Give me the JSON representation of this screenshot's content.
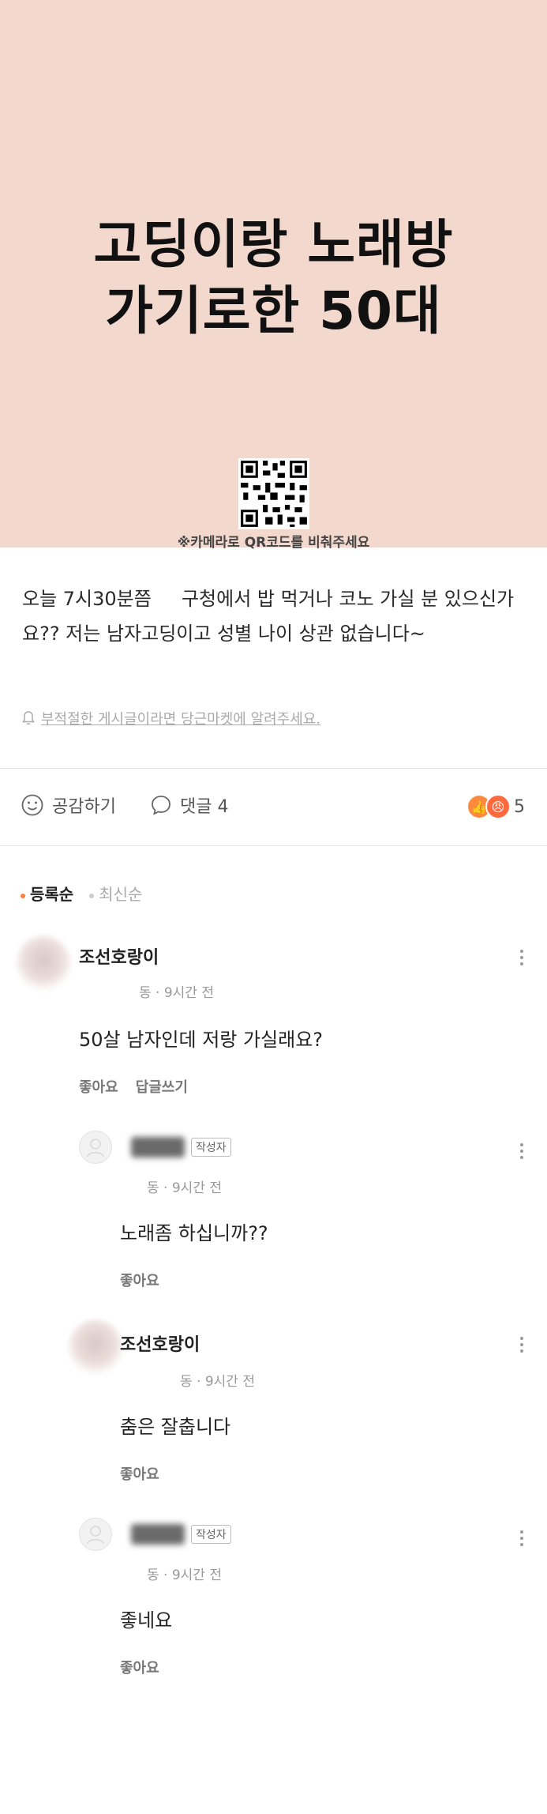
{
  "banner": {
    "title_line1": "고딩이랑 노래방",
    "title_line2": "가기로한 50대",
    "qr_caption": "※카메라로 QR코드를 비춰주세요"
  },
  "post": {
    "line1": "오늘 7시30분쯤     구청에서 밥 먹거나 코노 가실 분 있으신가",
    "line2": "요?? 저는 남자고딩이고 성별 나이 상관 없습니다~",
    "report_text": "부적절한 게시글이라면 당근마켓에 알려주세요."
  },
  "actions": {
    "like_label": "공감하기",
    "comment_label": "댓글 4",
    "reaction_count": "5"
  },
  "sort": {
    "active": "등록순",
    "inactive": "최신순"
  },
  "comments": [
    {
      "nickname": "조선호랑이",
      "meta": "동 · 9시간 전",
      "text": "50살 남자인데 저랑 가실래요?",
      "like": "좋아요",
      "reply": "답글쓰기"
    },
    {
      "badge": "작성자",
      "meta": "동 · 9시간 전",
      "text": "노래좀 하십니까??",
      "like": "좋아요"
    },
    {
      "nickname": "조선호랑이",
      "meta": "동 · 9시간 전",
      "text": "춤은 잘춥니다",
      "like": "좋아요"
    },
    {
      "badge": "작성자",
      "meta": "동 · 9시간 전",
      "text": "좋네요",
      "like": "좋아요"
    }
  ],
  "colors": {
    "banner_bg": "#f3d8ce",
    "accent": "#ff7e36"
  },
  "icons": [
    "qr-code-icon",
    "bell-icon",
    "smile-icon",
    "speech-bubble-icon",
    "thumbs-up-icon",
    "angry-face-icon",
    "more-vertical-icon",
    "default-avatar-icon"
  ]
}
